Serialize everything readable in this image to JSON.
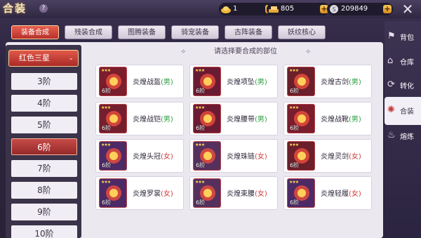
{
  "header": {
    "title": "合装",
    "help": "?",
    "resources": [
      {
        "icon": "gold-ingot-icon",
        "value": "1"
      },
      {
        "icon": "gold-bars-icon",
        "value": "805"
      },
      {
        "icon": "silver-coin-icon",
        "value": "209849"
      }
    ],
    "close": "✕"
  },
  "tabs": [
    {
      "label": "装备合成",
      "active": true
    },
    {
      "label": "残装合成",
      "active": false
    },
    {
      "label": "图腾装备",
      "active": false
    },
    {
      "label": "骑宠装备",
      "active": false
    },
    {
      "label": "古阵装备",
      "active": false
    },
    {
      "label": "妖纹核心",
      "active": false
    }
  ],
  "filter": {
    "selected": "红色三星",
    "chevron": "⌄"
  },
  "tiers": [
    {
      "label": "3阶",
      "active": false
    },
    {
      "label": "4阶",
      "active": false
    },
    {
      "label": "5阶",
      "active": false
    },
    {
      "label": "6阶",
      "active": true
    },
    {
      "label": "7阶",
      "active": false
    },
    {
      "label": "8阶",
      "active": false
    },
    {
      "label": "9阶",
      "active": false
    },
    {
      "label": "10阶",
      "active": false
    }
  ],
  "hint": "请选择要合成的部位",
  "items": [
    {
      "name": "炎煌战盔",
      "gender": "(男)",
      "g": "m",
      "level": "6阶",
      "stars": "★★★",
      "icon": "helmet-icon"
    },
    {
      "name": "炎煌项坠",
      "gender": "(男)",
      "g": "m",
      "level": "6阶",
      "stars": "★★★",
      "icon": "necklace-icon"
    },
    {
      "name": "炎煌古剑",
      "gender": "(男)",
      "g": "m",
      "level": "6阶",
      "stars": "★★★",
      "icon": "sword-icon"
    },
    {
      "name": "炎煌战铠",
      "gender": "(男)",
      "g": "m",
      "level": "6阶",
      "stars": "★★★",
      "icon": "armor-icon"
    },
    {
      "name": "炎煌腰带",
      "gender": "(男)",
      "g": "m",
      "level": "6阶",
      "stars": "★★★",
      "icon": "belt-icon"
    },
    {
      "name": "炎煌战靴",
      "gender": "(男)",
      "g": "m",
      "level": "6阶",
      "stars": "★★★",
      "icon": "boots-icon"
    },
    {
      "name": "炎煌头冠",
      "gender": "(女)",
      "g": "f",
      "level": "6阶",
      "stars": "★★★",
      "icon": "crown-icon"
    },
    {
      "name": "炎煌珠链",
      "gender": "(女)",
      "g": "f",
      "level": "6阶",
      "stars": "★★★",
      "icon": "bead-necklace-icon"
    },
    {
      "name": "炎煌灵剑",
      "gender": "(女)",
      "g": "f",
      "level": "6阶",
      "stars": "★★★",
      "icon": "spirit-sword-icon"
    },
    {
      "name": "炎煌罗裳",
      "gender": "(女)",
      "g": "f",
      "level": "6阶",
      "stars": "★★★",
      "icon": "robe-icon"
    },
    {
      "name": "炎煌束腰",
      "gender": "(女)",
      "g": "f",
      "level": "6阶",
      "stars": "★★★",
      "icon": "sash-icon"
    },
    {
      "name": "炎煌轻履",
      "gender": "(女)",
      "g": "f",
      "level": "6阶",
      "stars": "★★★",
      "icon": "slippers-icon"
    }
  ],
  "sidenav": [
    {
      "label": "背包",
      "icon": "bag-icon",
      "glyph": "⚑",
      "active": false
    },
    {
      "label": "仓库",
      "icon": "warehouse-icon",
      "glyph": "⌂",
      "active": false
    },
    {
      "label": "转化",
      "icon": "convert-icon",
      "glyph": "⟳",
      "active": false
    },
    {
      "label": "合装",
      "icon": "combine-icon",
      "glyph": "✺",
      "active": true
    },
    {
      "label": "熔炼",
      "icon": "smelt-icon",
      "glyph": "♨",
      "active": false
    }
  ],
  "colors": {
    "accent": "#c43b3b",
    "male": "#2ea043",
    "female": "#d23b3b"
  }
}
